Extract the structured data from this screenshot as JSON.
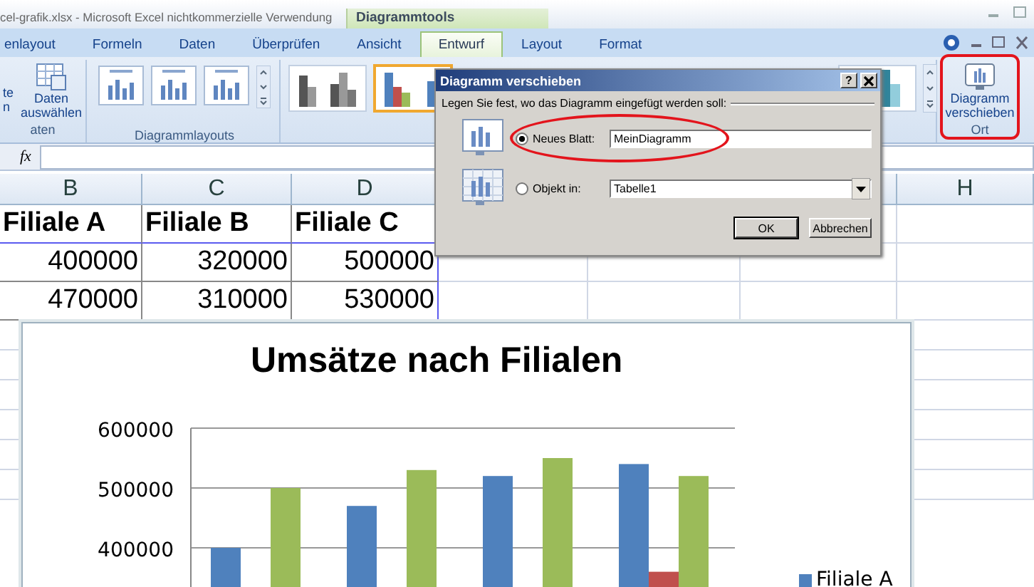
{
  "window": {
    "title": "cel-grafik.xlsx - Microsoft Excel nichtkommerzielle Verwendung",
    "context_group": "Diagrammtools"
  },
  "tabs": [
    {
      "label": "enlayout",
      "selected": false
    },
    {
      "label": "Formeln",
      "selected": false
    },
    {
      "label": "Daten",
      "selected": false
    },
    {
      "label": "Überprüfen",
      "selected": false
    },
    {
      "label": "Ansicht",
      "selected": false
    },
    {
      "label": "Entwurf",
      "selected": true
    },
    {
      "label": "Layout",
      "selected": false
    },
    {
      "label": "Format",
      "selected": false
    }
  ],
  "ribbon": {
    "cut_button_lines": [
      "te",
      "n"
    ],
    "data_button": "Daten auswählen",
    "data_group": "aten",
    "layouts_group": "Diagrammlayouts",
    "styles": [
      {
        "kind": "gray",
        "selected": false
      },
      {
        "kind": "colorful",
        "selected": true
      },
      {
        "kind": "teal",
        "selected": false
      }
    ],
    "move_button": {
      "label": "Diagramm verschieben",
      "highlighted": true
    },
    "place_group": "Ort"
  },
  "formula_bar": {
    "function_label": "fx"
  },
  "sheet": {
    "column_headers": [
      "B",
      "C",
      "D"
    ],
    "right_column_header": "H",
    "rows": [
      [
        "Filiale A",
        "Filiale B",
        "Filiale C"
      ],
      [
        "400000",
        "320000",
        "500000"
      ],
      [
        "470000",
        "310000",
        "530000"
      ]
    ]
  },
  "dialog": {
    "title": "Diagramm verschieben",
    "help": "?",
    "instruction": "Legen Sie fest, wo das Diagramm eingefügt werden soll:",
    "options": [
      {
        "kind": "text",
        "label": "Neues Blatt:",
        "value": "MeinDiagramm",
        "selected": true,
        "highlighted": true
      },
      {
        "kind": "dropdown",
        "label": "Objekt in:",
        "value": "Tabelle1",
        "selected": false
      }
    ],
    "buttons": [
      "OK",
      "Abbrechen"
    ]
  },
  "chart": {
    "chart_data": {
      "type": "bar",
      "title": "Umsätze nach Filialen",
      "ylim": [
        320000,
        600000
      ],
      "yticks": [
        400000,
        500000,
        600000
      ],
      "series": [
        {
          "name": "Filiale A",
          "color": "#4f81bd",
          "values": [
            400000,
            470000,
            520000,
            540000
          ]
        },
        {
          "color": "#c0504d",
          "values": [
            null,
            null,
            null,
            360000
          ]
        },
        {
          "color": "#9bbb59",
          "values": [
            500000,
            530000,
            550000,
            520000
          ]
        }
      ]
    }
  }
}
